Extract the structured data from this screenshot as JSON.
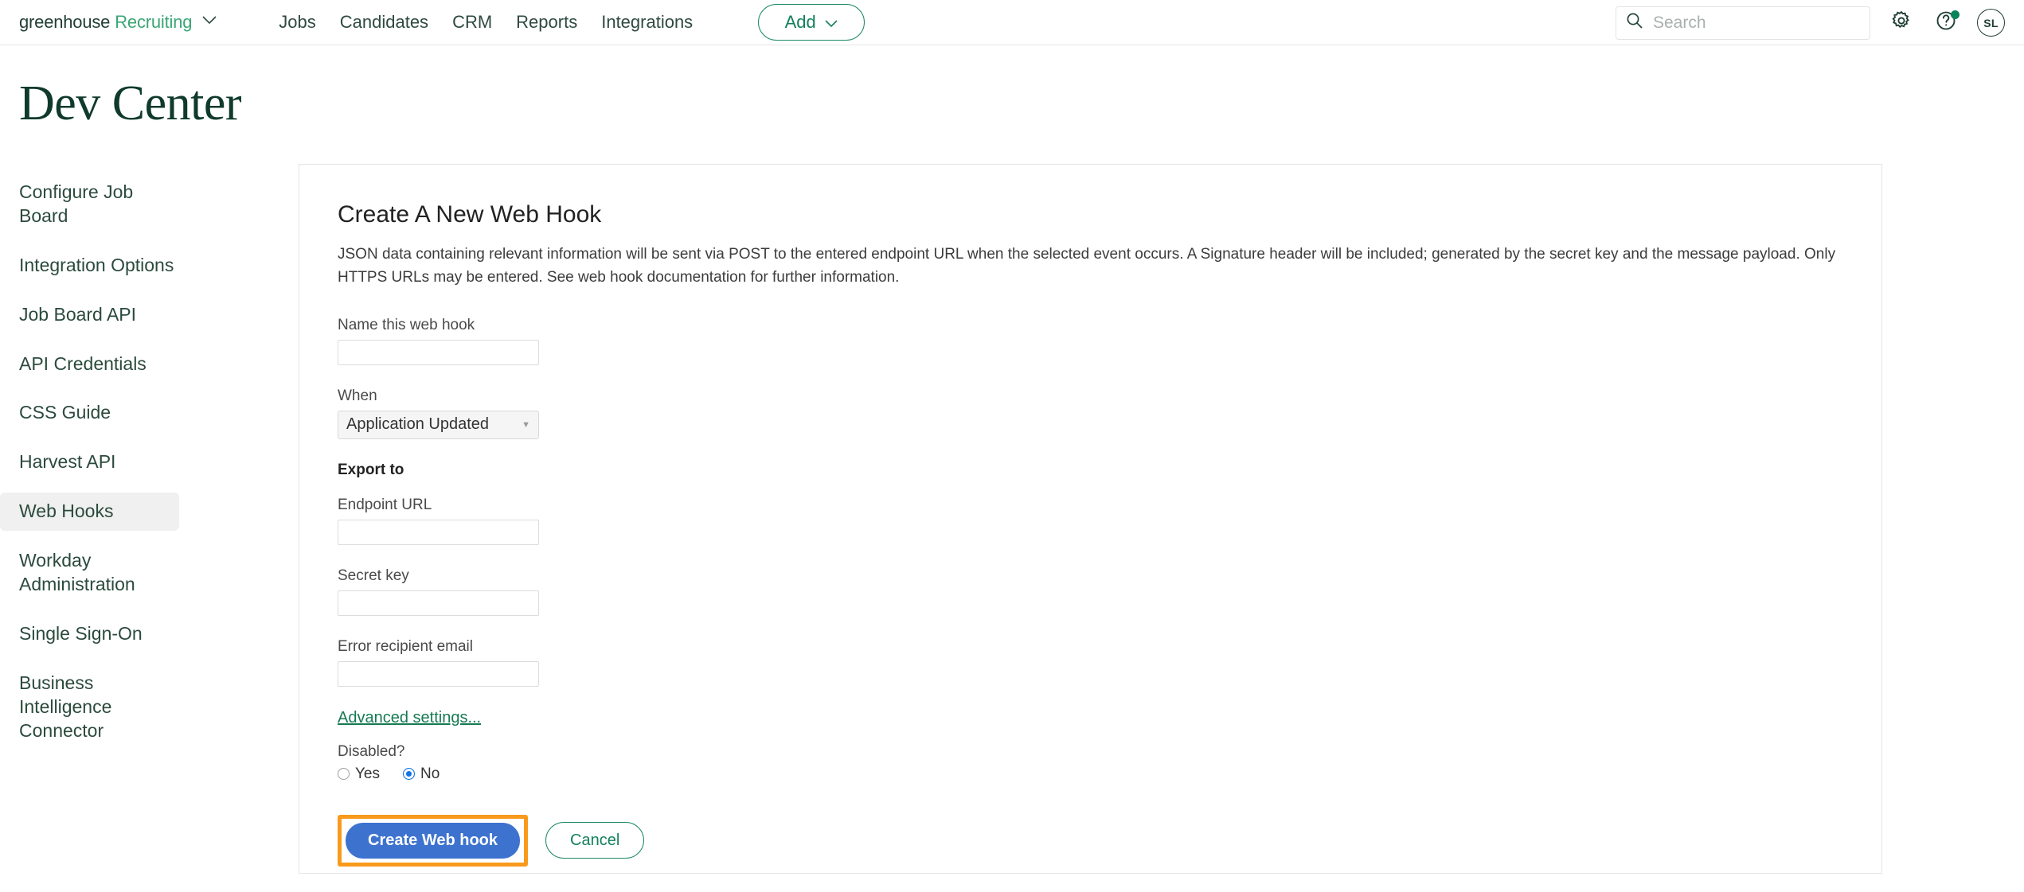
{
  "header": {
    "brand_primary": "greenhouse",
    "brand_secondary": "Recruiting",
    "nav_items": [
      {
        "label": "Jobs"
      },
      {
        "label": "Candidates"
      },
      {
        "label": "CRM"
      },
      {
        "label": "Reports"
      },
      {
        "label": "Integrations"
      }
    ],
    "add_button": "Add",
    "search": {
      "value": "",
      "placeholder": "Search"
    },
    "avatar_initials": "SL"
  },
  "page": {
    "title": "Dev Center"
  },
  "sidebar": {
    "items": [
      {
        "label": "Configure Job Board",
        "active": false
      },
      {
        "label": "Integration Options",
        "active": false
      },
      {
        "label": "Job Board API",
        "active": false
      },
      {
        "label": "API Credentials",
        "active": false
      },
      {
        "label": "CSS Guide",
        "active": false
      },
      {
        "label": "Harvest API",
        "active": false
      },
      {
        "label": "Web Hooks",
        "active": true
      },
      {
        "label": "Workday Administration",
        "active": false
      },
      {
        "label": "Single Sign-On",
        "active": false
      },
      {
        "label": "Business Intelligence Connector",
        "active": false
      }
    ]
  },
  "main": {
    "card_title": "Create A New Web Hook",
    "card_description": "JSON data containing relevant information will be sent via POST to the entered endpoint URL when the selected event occurs. A Signature header will be included; generated by the secret key and the message payload. Only HTTPS URLs may be entered. See web hook documentation for further information.",
    "name_label": "Name this web hook",
    "name_value": "",
    "when_label": "When",
    "when_selected": "Application Updated",
    "export_heading": "Export to",
    "endpoint_label": "Endpoint URL",
    "endpoint_value": "",
    "secret_label": "Secret key",
    "secret_value": "",
    "error_email_label": "Error recipient email",
    "error_email_value": "",
    "advanced_link": "Advanced settings...",
    "disabled_label": "Disabled?",
    "disabled_yes": "Yes",
    "disabled_no": "No",
    "disabled_selected": "No",
    "submit_label": "Create Web hook",
    "cancel_label": "Cancel"
  },
  "colors": {
    "brand_green": "#3ba676",
    "title_green": "#0f3a2c",
    "link_green": "#157a52",
    "primary_button_blue": "#3d72cf",
    "highlight_orange": "#f99a1c",
    "radio_blue": "#1073e6",
    "sidebar_active_bg": "#eff0ef"
  }
}
